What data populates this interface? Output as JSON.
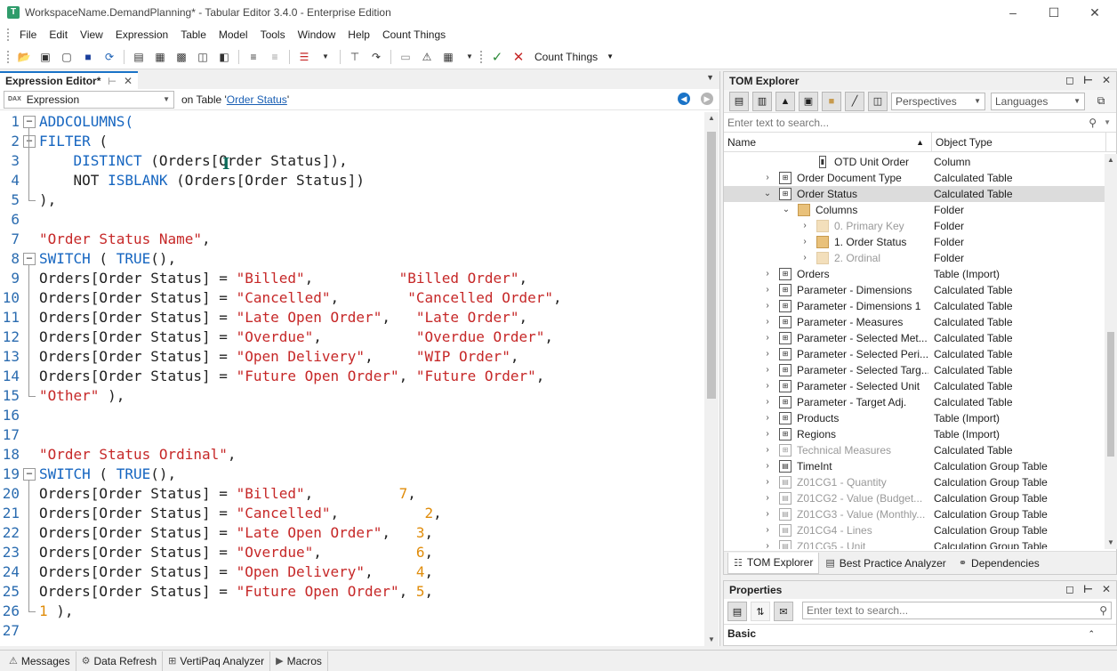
{
  "window": {
    "title": "WorkspaceName.DemandPlanning* - Tabular Editor 3.4.0 - Enterprise Edition",
    "app_icon": "T"
  },
  "menu": [
    "File",
    "Edit",
    "View",
    "Expression",
    "Table",
    "Model",
    "Tools",
    "Window",
    "Help",
    "Count Things"
  ],
  "toolbar": {
    "count_things_label": "Count Things"
  },
  "editor": {
    "tab_title": "Expression Editor*",
    "expression_select": "Expression",
    "dax_badge": "DAX",
    "on_table_prefix": "on Table '",
    "table_link": "Order Status",
    "on_table_suffix": "'",
    "lines": [
      {
        "n": "1",
        "fold": "minus",
        "tokens": [
          {
            "t": "ADDCOLUMNS(",
            "c": "kw"
          }
        ]
      },
      {
        "n": "2",
        "fold": "minus",
        "tokens": [
          {
            "t": "FILTER",
            "c": "kw"
          },
          {
            "t": " (",
            "c": "plain"
          }
        ]
      },
      {
        "n": "3",
        "tokens": [
          {
            "t": "    DISTINCT",
            "c": "kw"
          },
          {
            "t": " (Orders[Order Status]),",
            "c": "plain"
          }
        ]
      },
      {
        "n": "4",
        "tokens": [
          {
            "t": "    NOT ",
            "c": "plain"
          },
          {
            "t": "ISBLANK",
            "c": "kw"
          },
          {
            "t": " (Orders[Order Status])",
            "c": "plain"
          }
        ]
      },
      {
        "n": "5",
        "fold": "end",
        "tokens": [
          {
            "t": "),",
            "c": "plain"
          }
        ]
      },
      {
        "n": "6",
        "tokens": []
      },
      {
        "n": "7",
        "tokens": [
          {
            "t": "\"Order Status Name\"",
            "c": "str"
          },
          {
            "t": ",",
            "c": "plain"
          }
        ]
      },
      {
        "n": "8",
        "fold": "minus",
        "tokens": [
          {
            "t": "SWITCH",
            "c": "kw"
          },
          {
            "t": " ( ",
            "c": "plain"
          },
          {
            "t": "TRUE",
            "c": "kw"
          },
          {
            "t": "(),",
            "c": "plain"
          }
        ]
      },
      {
        "n": "9",
        "tokens": [
          {
            "t": "Orders[Order Status] = ",
            "c": "plain"
          },
          {
            "t": "\"Billed\"",
            "c": "str"
          },
          {
            "t": ",          ",
            "c": "plain"
          },
          {
            "t": "\"Billed Order\"",
            "c": "str"
          },
          {
            "t": ",",
            "c": "plain"
          }
        ]
      },
      {
        "n": "10",
        "tokens": [
          {
            "t": "Orders[Order Status] = ",
            "c": "plain"
          },
          {
            "t": "\"Cancelled\"",
            "c": "str"
          },
          {
            "t": ",        ",
            "c": "plain"
          },
          {
            "t": "\"Cancelled Order\"",
            "c": "str"
          },
          {
            "t": ",",
            "c": "plain"
          }
        ]
      },
      {
        "n": "11",
        "tokens": [
          {
            "t": "Orders[Order Status] = ",
            "c": "plain"
          },
          {
            "t": "\"Late Open Order\"",
            "c": "str"
          },
          {
            "t": ",   ",
            "c": "plain"
          },
          {
            "t": "\"Late Order\"",
            "c": "str"
          },
          {
            "t": ",",
            "c": "plain"
          }
        ]
      },
      {
        "n": "12",
        "tokens": [
          {
            "t": "Orders[Order Status] = ",
            "c": "plain"
          },
          {
            "t": "\"Overdue\"",
            "c": "str"
          },
          {
            "t": ",           ",
            "c": "plain"
          },
          {
            "t": "\"Overdue Order\"",
            "c": "str"
          },
          {
            "t": ",",
            "c": "plain"
          }
        ]
      },
      {
        "n": "13",
        "tokens": [
          {
            "t": "Orders[Order Status] = ",
            "c": "plain"
          },
          {
            "t": "\"Open Delivery\"",
            "c": "str"
          },
          {
            "t": ",     ",
            "c": "plain"
          },
          {
            "t": "\"WIP Order\"",
            "c": "str"
          },
          {
            "t": ",",
            "c": "plain"
          }
        ]
      },
      {
        "n": "14",
        "tokens": [
          {
            "t": "Orders[Order Status] = ",
            "c": "plain"
          },
          {
            "t": "\"Future Open Order\"",
            "c": "str"
          },
          {
            "t": ", ",
            "c": "plain"
          },
          {
            "t": "\"Future Order\"",
            "c": "str"
          },
          {
            "t": ",",
            "c": "plain"
          }
        ]
      },
      {
        "n": "15",
        "fold": "end",
        "tokens": [
          {
            "t": "\"Other\"",
            "c": "str"
          },
          {
            "t": " ),",
            "c": "plain"
          }
        ]
      },
      {
        "n": "16",
        "tokens": []
      },
      {
        "n": "17",
        "tokens": []
      },
      {
        "n": "18",
        "tokens": [
          {
            "t": "\"Order Status Ordinal\"",
            "c": "str"
          },
          {
            "t": ",",
            "c": "plain"
          }
        ]
      },
      {
        "n": "19",
        "fold": "minus",
        "tokens": [
          {
            "t": "SWITCH",
            "c": "kw"
          },
          {
            "t": " ( ",
            "c": "plain"
          },
          {
            "t": "TRUE",
            "c": "kw"
          },
          {
            "t": "(),",
            "c": "plain"
          }
        ]
      },
      {
        "n": "20",
        "tokens": [
          {
            "t": "Orders[Order Status] = ",
            "c": "plain"
          },
          {
            "t": "\"Billed\"",
            "c": "str"
          },
          {
            "t": ",          ",
            "c": "plain"
          },
          {
            "t": "7",
            "c": "num"
          },
          {
            "t": ",",
            "c": "plain"
          }
        ]
      },
      {
        "n": "21",
        "tokens": [
          {
            "t": "Orders[Order Status] = ",
            "c": "plain"
          },
          {
            "t": "\"Cancelled\"",
            "c": "str"
          },
          {
            "t": ",          ",
            "c": "plain"
          },
          {
            "t": "2",
            "c": "num"
          },
          {
            "t": ",",
            "c": "plain"
          }
        ]
      },
      {
        "n": "22",
        "tokens": [
          {
            "t": "Orders[Order Status] = ",
            "c": "plain"
          },
          {
            "t": "\"Late Open Order\"",
            "c": "str"
          },
          {
            "t": ",   ",
            "c": "plain"
          },
          {
            "t": "3",
            "c": "num"
          },
          {
            "t": ",",
            "c": "plain"
          }
        ]
      },
      {
        "n": "23",
        "tokens": [
          {
            "t": "Orders[Order Status] = ",
            "c": "plain"
          },
          {
            "t": "\"Overdue\"",
            "c": "str"
          },
          {
            "t": ",           ",
            "c": "plain"
          },
          {
            "t": "6",
            "c": "num"
          },
          {
            "t": ",",
            "c": "plain"
          }
        ]
      },
      {
        "n": "24",
        "tokens": [
          {
            "t": "Orders[Order Status] = ",
            "c": "plain"
          },
          {
            "t": "\"Open Delivery\"",
            "c": "str"
          },
          {
            "t": ",     ",
            "c": "plain"
          },
          {
            "t": "4",
            "c": "num"
          },
          {
            "t": ",",
            "c": "plain"
          }
        ]
      },
      {
        "n": "25",
        "tokens": [
          {
            "t": "Orders[Order Status] = ",
            "c": "plain"
          },
          {
            "t": "\"Future Open Order\"",
            "c": "str"
          },
          {
            "t": ", ",
            "c": "plain"
          },
          {
            "t": "5",
            "c": "num"
          },
          {
            "t": ",",
            "c": "plain"
          }
        ]
      },
      {
        "n": "26",
        "fold": "end",
        "tokens": [
          {
            "t": "1",
            "c": "num"
          },
          {
            "t": " ),",
            "c": "plain"
          }
        ]
      },
      {
        "n": "27",
        "tokens": []
      }
    ]
  },
  "bottom_tabs": [
    {
      "icon": "messages-icon",
      "label": "Messages"
    },
    {
      "icon": "data-refresh-icon",
      "label": "Data Refresh"
    },
    {
      "icon": "vertipaq-icon",
      "label": "VertiPaq Analyzer"
    },
    {
      "icon": "macros-icon",
      "label": "Macros"
    }
  ],
  "tom": {
    "title": "TOM Explorer",
    "perspectives": "Perspectives",
    "languages": "Languages",
    "search_placeholder": "Enter text to search...",
    "col_name": "Name",
    "col_type": "Object Type",
    "rows": [
      {
        "level": 3,
        "exp": "",
        "icon": "column",
        "name": "OTD Unit Order",
        "type": "Column",
        "dim": false
      },
      {
        "level": 1,
        "exp": ">",
        "icon": "calc-table",
        "name": "Order Document Type",
        "type": "Calculated Table",
        "dim": false
      },
      {
        "level": 1,
        "exp": "v",
        "icon": "calc-table",
        "name": "Order Status",
        "type": "Calculated Table",
        "dim": false,
        "selected": true
      },
      {
        "level": 2,
        "exp": "v",
        "icon": "folder",
        "name": "Columns",
        "type": "Folder",
        "dim": false
      },
      {
        "level": 3,
        "exp": ">",
        "icon": "folder",
        "name": "0. Primary Key",
        "type": "Folder",
        "dim": true
      },
      {
        "level": 3,
        "exp": ">",
        "icon": "folder",
        "name": "1. Order Status",
        "type": "Folder",
        "dim": false
      },
      {
        "level": 3,
        "exp": ">",
        "icon": "folder",
        "name": "2. Ordinal",
        "type": "Folder",
        "dim": true
      },
      {
        "level": 1,
        "exp": ">",
        "icon": "table",
        "name": "Orders",
        "type": "Table (Import)",
        "dim": false
      },
      {
        "level": 1,
        "exp": ">",
        "icon": "calc-table",
        "name": "Parameter - Dimensions",
        "type": "Calculated Table",
        "dim": false
      },
      {
        "level": 1,
        "exp": ">",
        "icon": "calc-table",
        "name": "Parameter - Dimensions 1",
        "type": "Calculated Table",
        "dim": false
      },
      {
        "level": 1,
        "exp": ">",
        "icon": "calc-table",
        "name": "Parameter - Measures",
        "type": "Calculated Table",
        "dim": false
      },
      {
        "level": 1,
        "exp": ">",
        "icon": "calc-table",
        "name": "Parameter - Selected Met...",
        "type": "Calculated Table",
        "dim": false
      },
      {
        "level": 1,
        "exp": ">",
        "icon": "calc-table",
        "name": "Parameter - Selected Peri...",
        "type": "Calculated Table",
        "dim": false
      },
      {
        "level": 1,
        "exp": ">",
        "icon": "calc-table",
        "name": "Parameter - Selected Targ...",
        "type": "Calculated Table",
        "dim": false
      },
      {
        "level": 1,
        "exp": ">",
        "icon": "calc-table",
        "name": "Parameter - Selected Unit",
        "type": "Calculated Table",
        "dim": false
      },
      {
        "level": 1,
        "exp": ">",
        "icon": "calc-table",
        "name": "Parameter - Target Adj.",
        "type": "Calculated Table",
        "dim": false
      },
      {
        "level": 1,
        "exp": ">",
        "icon": "table",
        "name": "Products",
        "type": "Table (Import)",
        "dim": false
      },
      {
        "level": 1,
        "exp": ">",
        "icon": "table",
        "name": "Regions",
        "type": "Table (Import)",
        "dim": false
      },
      {
        "level": 1,
        "exp": ">",
        "icon": "calc-table",
        "name": "Technical Measures",
        "type": "Calculated Table",
        "dim": true
      },
      {
        "level": 1,
        "exp": ">",
        "icon": "calc-group",
        "name": "TimeInt",
        "type": "Calculation Group Table",
        "dim": false
      },
      {
        "level": 1,
        "exp": ">",
        "icon": "calc-group",
        "name": "Z01CG1 - Quantity",
        "type": "Calculation Group Table",
        "dim": true
      },
      {
        "level": 1,
        "exp": ">",
        "icon": "calc-group",
        "name": "Z01CG2 - Value (Budget...",
        "type": "Calculation Group Table",
        "dim": true
      },
      {
        "level": 1,
        "exp": ">",
        "icon": "calc-group",
        "name": "Z01CG3 - Value (Monthly...",
        "type": "Calculation Group Table",
        "dim": true
      },
      {
        "level": 1,
        "exp": ">",
        "icon": "calc-group",
        "name": "Z01CG4 - Lines",
        "type": "Calculation Group Table",
        "dim": true
      },
      {
        "level": 1,
        "exp": ">",
        "icon": "calc-group",
        "name": "Z01CG5 - Unit",
        "type": "Calculation Group Table",
        "dim": true
      }
    ],
    "tabs": [
      {
        "icon": "tom-explorer-icon",
        "label": "TOM Explorer",
        "active": true
      },
      {
        "icon": "best-practice-icon",
        "label": "Best Practice Analyzer",
        "active": false
      },
      {
        "icon": "dependencies-icon",
        "label": "Dependencies",
        "active": false
      }
    ]
  },
  "properties": {
    "title": "Properties",
    "search_placeholder": "Enter text to search...",
    "category": "Basic"
  },
  "colors": {
    "keyword": "#1565c0",
    "string": "#c62828",
    "number": "#e08c0a",
    "accent": "#1a73c7"
  }
}
